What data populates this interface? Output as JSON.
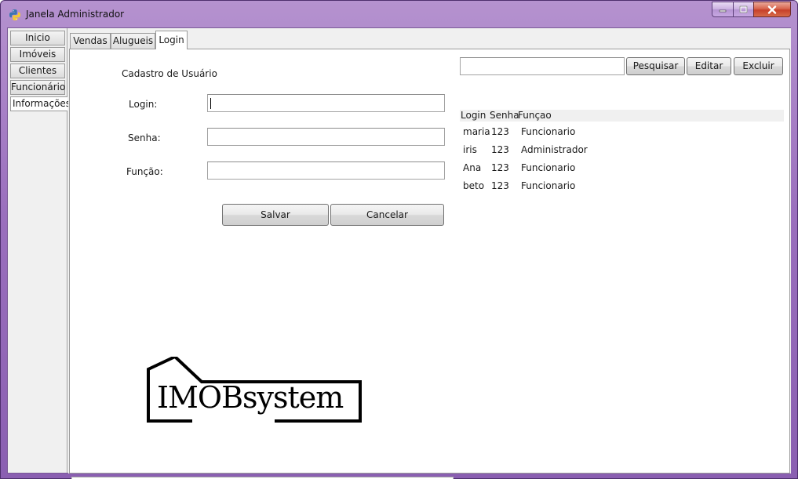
{
  "window": {
    "title": "Janela Administrador"
  },
  "nav": {
    "items": [
      {
        "label": "Inicio"
      },
      {
        "label": "Imóveis"
      },
      {
        "label": "Clientes"
      },
      {
        "label": "Funcionário"
      },
      {
        "label": "Informações"
      }
    ],
    "active": "Informações"
  },
  "tabs": [
    {
      "label": "Vendas"
    },
    {
      "label": "Alugueis"
    },
    {
      "label": "Login"
    }
  ],
  "form": {
    "section_title": "Cadastro de Usuário",
    "login_label": "Login:",
    "login_value": "",
    "senha_label": "Senha:",
    "senha_value": "",
    "funcao_label": "Função:",
    "funcao_value": "",
    "save_label": "Salvar",
    "cancel_label": "Cancelar"
  },
  "search": {
    "value": "",
    "search_label": "Pesquisar",
    "edit_label": "Editar",
    "delete_label": "Excluir"
  },
  "table": {
    "columns": [
      "Login",
      "Senha",
      "Funçao"
    ],
    "rows": [
      [
        "maria",
        "123",
        "Funcionario"
      ],
      [
        "iris",
        "123",
        "Administrador"
      ],
      [
        "Ana",
        "123",
        "Funcionario"
      ],
      [
        "beto",
        "123",
        "Funcionario"
      ]
    ]
  },
  "logo": {
    "text": "IMOBsystem"
  },
  "colors": {
    "frame": "#9a6fbd",
    "close_button": "#c7402a"
  }
}
